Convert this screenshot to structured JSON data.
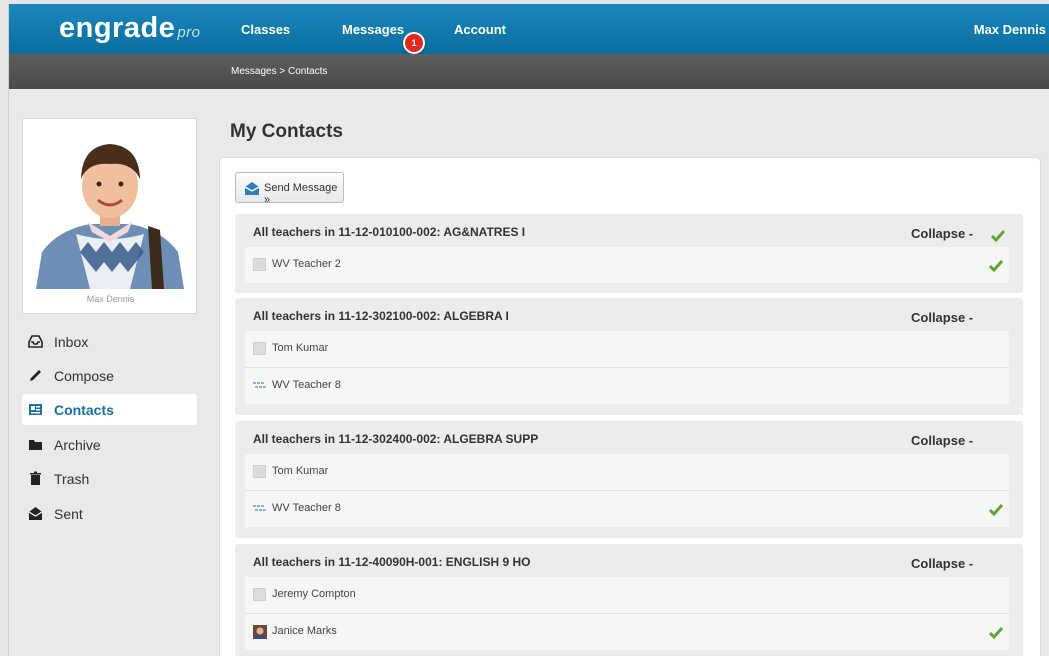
{
  "app": {
    "logo": "engrade",
    "logo_suffix": "pro",
    "nav": [
      "Classes",
      "Messages",
      "Account"
    ],
    "messages_badge": "1",
    "user": "Max Dennis",
    "breadcrumb": "Messages > Contacts"
  },
  "sidebar": {
    "profile_name": "Max Dennis",
    "items": [
      {
        "label": "Inbox",
        "icon": "inbox-icon",
        "active": false
      },
      {
        "label": "Compose",
        "icon": "pencil-icon",
        "active": false
      },
      {
        "label": "Contacts",
        "icon": "contacts-icon",
        "active": true
      },
      {
        "label": "Archive",
        "icon": "folder-icon",
        "active": false
      },
      {
        "label": "Trash",
        "icon": "trash-icon",
        "active": false
      },
      {
        "label": "Sent",
        "icon": "sent-icon",
        "active": false
      }
    ]
  },
  "main": {
    "title": "My Contacts",
    "send_button": "Send Message »",
    "groups": [
      {
        "title": "All teachers in 11-12-010100-002: AG&NATRES I",
        "collapse": "Collapse -",
        "collapse_checked": true,
        "contacts": [
          {
            "name": "WV Teacher 2",
            "checked": true,
            "avatar": "blank"
          }
        ]
      },
      {
        "title": "All teachers in 11-12-302100-002: ALGEBRA I",
        "collapse": "Collapse -",
        "collapse_checked": false,
        "contacts": [
          {
            "name": "Tom Kumar",
            "checked": false,
            "avatar": "blank"
          },
          {
            "name": "WV Teacher 8",
            "checked": false,
            "avatar": "pattern"
          }
        ]
      },
      {
        "title": "All teachers in 11-12-302400-002: ALGEBRA SUPP",
        "collapse": "Collapse -",
        "collapse_checked": false,
        "contacts": [
          {
            "name": "Tom Kumar",
            "checked": false,
            "avatar": "blank"
          },
          {
            "name": "WV Teacher 8",
            "checked": true,
            "avatar": "pattern"
          }
        ]
      },
      {
        "title": "All teachers in 11-12-40090H-001: ENGLISH 9 HO",
        "collapse": "Collapse -",
        "collapse_checked": false,
        "contacts": [
          {
            "name": "Jeremy Compton",
            "checked": false,
            "avatar": "blank"
          },
          {
            "name": "Janice Marks",
            "checked": true,
            "avatar": "photo"
          }
        ]
      }
    ]
  },
  "colors": {
    "topbar": "#1a88bd",
    "crumbbar": "#555555",
    "badge": "#e02a1f",
    "check": "#5aa832",
    "active_link": "#1a6fa3"
  }
}
